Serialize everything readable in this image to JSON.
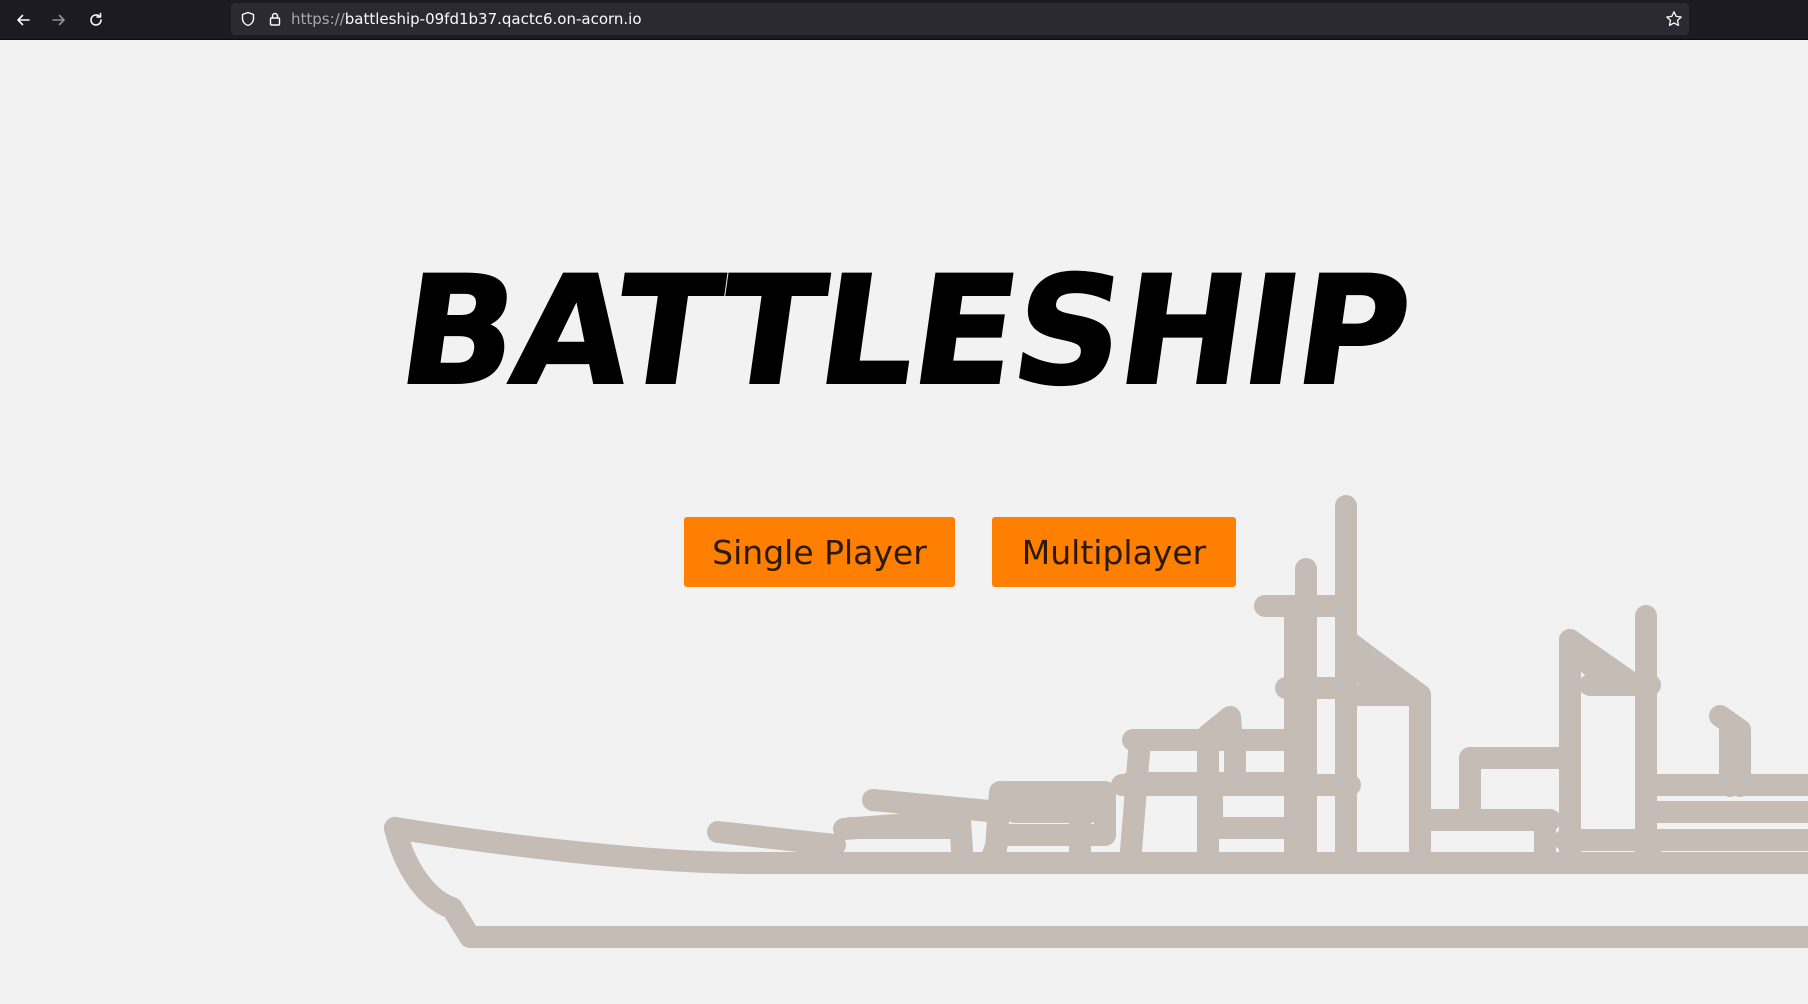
{
  "browser": {
    "url_protocol": "https://",
    "url_host": "battleship-09fd1b37.qactc6.on-acorn.io",
    "icons": {
      "back": "back-arrow-icon",
      "forward": "forward-arrow-icon",
      "reload": "reload-icon",
      "shield": "shield-icon",
      "lock": "lock-icon",
      "bookmark": "star-icon"
    }
  },
  "page": {
    "title": "BATTLESHIP",
    "buttons": {
      "single_player": "Single Player",
      "multiplayer": "Multiplayer"
    },
    "background_image": "battleship-outline-illustration"
  },
  "colors": {
    "page_background": "#f2f2f2",
    "button_background": "#ff7f00",
    "title_color": "#000000",
    "ship_outline": "#c4bcb5"
  }
}
